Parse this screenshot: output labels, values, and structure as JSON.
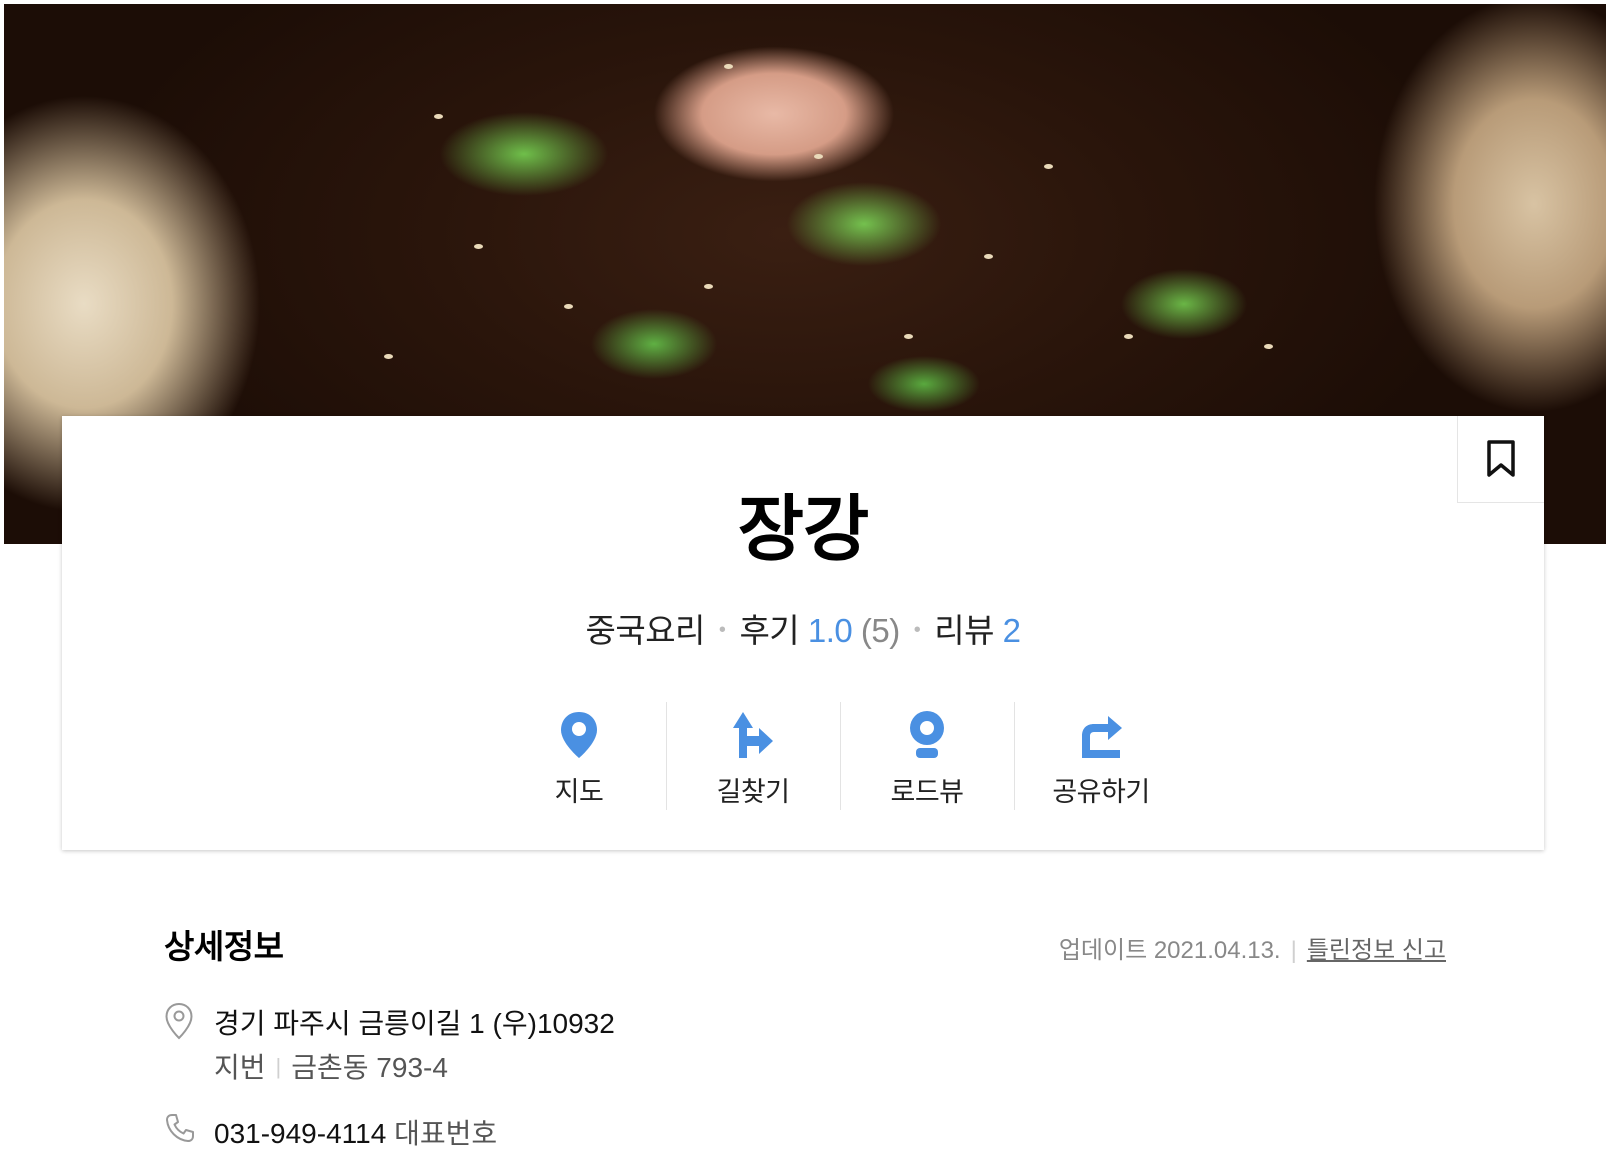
{
  "place": {
    "name": "장강",
    "category": "중국요리",
    "review_label": "후기",
    "rating": "1.0",
    "rating_count": "(5)",
    "blog_label": "리뷰",
    "blog_count": "2"
  },
  "actions": [
    {
      "label": "지도",
      "icon": "map-pin-icon"
    },
    {
      "label": "길찾기",
      "icon": "directions-icon"
    },
    {
      "label": "로드뷰",
      "icon": "roadview-icon"
    },
    {
      "label": "공유하기",
      "icon": "share-icon"
    }
  ],
  "details": {
    "title": "상세정보",
    "update_text": "업데이트 2021.04.13.",
    "report_label": "틀린정보 신고",
    "address": "경기 파주시 금릉이길 1 (우)10932",
    "lot_label": "지번",
    "lot_address": "금촌동 793-4",
    "phone": "031-949-4114",
    "phone_label": "대표번호"
  },
  "colors": {
    "accent": "#4a90e2",
    "text": "#222222",
    "muted": "#888888"
  }
}
